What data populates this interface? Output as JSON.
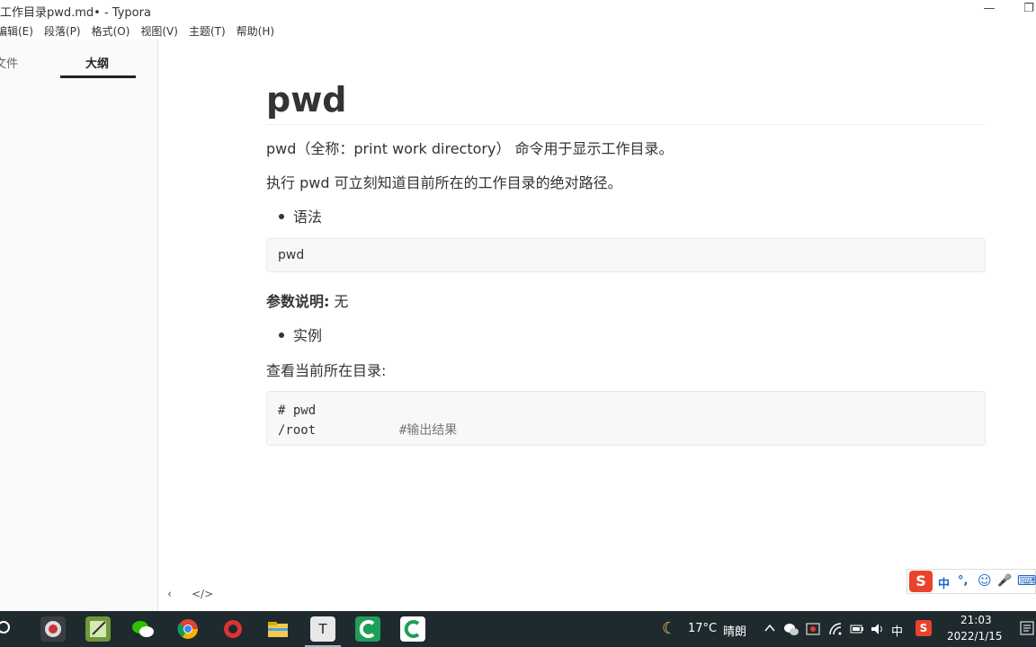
{
  "window": {
    "title": "工作目录pwd.md• - Typora",
    "minimize_icon": "—",
    "maximize_icon": "❐"
  },
  "menu": [
    "编辑(E)",
    "段落(P)",
    "格式(O)",
    "视图(V)",
    "主题(T)",
    "帮助(H)"
  ],
  "sidebar": {
    "tab_files": "文件",
    "tab_outline": "大纲",
    "back_icon": "‹",
    "source_icon": "</>"
  },
  "doc": {
    "heading": "pwd",
    "p1": "pwd（全称：print work directory） 命令用于显示工作目录。",
    "p2": "执行 pwd 可立刻知道目前所在的工作目录的绝对路径。",
    "bullet1": "语法",
    "code1": "pwd",
    "param_label": "参数说明:",
    "param_value": " 无",
    "bullet2": "实例",
    "p3": "查看当前所在目录:",
    "code2_line1": "# pwd",
    "code2_line2": "/root           ",
    "code2_comment": "#输出结果"
  },
  "ime": {
    "logo": "S",
    "mode": "中",
    "punct": "°,",
    "emoji_icon": "☺",
    "mic_icon": "🎤",
    "kb_icon": "⌨"
  },
  "taskbar": {
    "weather_icon": "☾",
    "temperature": "17°C",
    "weather": "晴朗",
    "lang": "中",
    "time": "21:03",
    "date": "2022/1/15",
    "typora_letter": "T"
  },
  "colors": {
    "taskbar_bg": "#1f2a2e",
    "code_bg": "#f8f8f8",
    "sogou_red": "#e9442b"
  }
}
